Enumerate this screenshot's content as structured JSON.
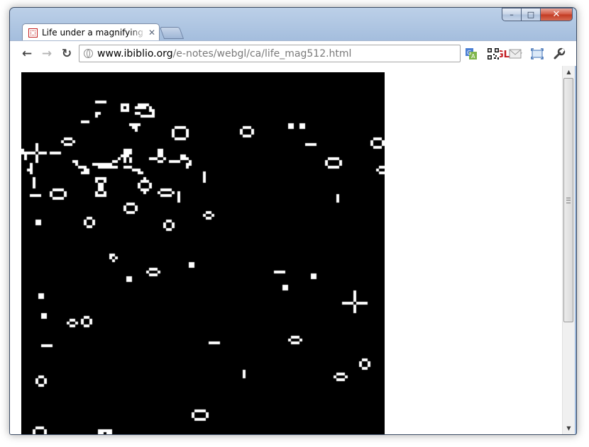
{
  "window": {
    "caption_buttons": {
      "minimize_icon": "minimize-icon",
      "maximize_icon": "maximize-icon",
      "close_icon": "close-icon"
    }
  },
  "tabs": [
    {
      "title": "Life under a magnifying gla",
      "active": true,
      "favicon": "canvas-favicon-icon"
    }
  ],
  "toolbar": {
    "back_icon": "back-arrow-icon",
    "forward_icon": "forward-arrow-icon",
    "reload_icon": "reload-icon",
    "omnibox": {
      "domain": "www.ibiblio.org",
      "path": "/e-notes/webgl/ca/life_mag512.html"
    },
    "badge": "GL",
    "extensions": [
      "translate-icon",
      "qr-code-icon",
      "mail-icon",
      "fullscreen-icon",
      "wrench-icon"
    ]
  },
  "colors": {
    "canvas_background": "#000000",
    "cell_color": "#ffffff",
    "gl_badge": "#c2191e"
  },
  "life_canvas": {
    "description_type": "conway-game-of-life-grid",
    "cells": [
      [
        26,
        10
      ],
      [
        27,
        10
      ],
      [
        28,
        10
      ],
      [
        29,
        10
      ],
      [
        35,
        11
      ],
      [
        36,
        11
      ],
      [
        37,
        11
      ],
      [
        35,
        12
      ],
      [
        37,
        12
      ],
      [
        35,
        13
      ],
      [
        36,
        13
      ],
      [
        37,
        13
      ],
      [
        40,
        12
      ],
      [
        41,
        12
      ],
      [
        42,
        12
      ],
      [
        41,
        11
      ],
      [
        42,
        11
      ],
      [
        43,
        11
      ],
      [
        44,
        11
      ],
      [
        43,
        12
      ],
      [
        45,
        12
      ],
      [
        45,
        13
      ],
      [
        46,
        13
      ],
      [
        46,
        14
      ],
      [
        40,
        14
      ],
      [
        41,
        14
      ],
      [
        42,
        15
      ],
      [
        43,
        15
      ],
      [
        44,
        15
      ],
      [
        45,
        15
      ],
      [
        46,
        15
      ],
      [
        21,
        17
      ],
      [
        22,
        17
      ],
      [
        23,
        17
      ],
      [
        26,
        14
      ],
      [
        27,
        14
      ],
      [
        26,
        15
      ],
      [
        54,
        19
      ],
      [
        55,
        19
      ],
      [
        56,
        19
      ],
      [
        57,
        19
      ],
      [
        54,
        23
      ],
      [
        55,
        23
      ],
      [
        56,
        23
      ],
      [
        57,
        23
      ],
      [
        53,
        20
      ],
      [
        53,
        21
      ],
      [
        53,
        22
      ],
      [
        58,
        20
      ],
      [
        58,
        21
      ],
      [
        58,
        22
      ],
      [
        38,
        18
      ],
      [
        39,
        18
      ],
      [
        40,
        18
      ],
      [
        41,
        18
      ],
      [
        39,
        19
      ],
      [
        40,
        19
      ],
      [
        40,
        20
      ],
      [
        78,
        19
      ],
      [
        79,
        19
      ],
      [
        80,
        19
      ],
      [
        77,
        20
      ],
      [
        81,
        20
      ],
      [
        77,
        21
      ],
      [
        81,
        21
      ],
      [
        78,
        22
      ],
      [
        79,
        22
      ],
      [
        80,
        22
      ],
      [
        94,
        18
      ],
      [
        95,
        18
      ],
      [
        94,
        19
      ],
      [
        95,
        19
      ],
      [
        98,
        18
      ],
      [
        99,
        18
      ],
      [
        98,
        19
      ],
      [
        99,
        19
      ],
      [
        100,
        25
      ],
      [
        101,
        25
      ],
      [
        102,
        25
      ],
      [
        103,
        25
      ],
      [
        124,
        23
      ],
      [
        125,
        23
      ],
      [
        126,
        23
      ],
      [
        123,
        24
      ],
      [
        127,
        24
      ],
      [
        123,
        25
      ],
      [
        127,
        25
      ],
      [
        124,
        26
      ],
      [
        125,
        26
      ],
      [
        126,
        26
      ],
      [
        15,
        23
      ],
      [
        16,
        23
      ],
      [
        17,
        23
      ],
      [
        14,
        24
      ],
      [
        18,
        24
      ],
      [
        15,
        25
      ],
      [
        16,
        25
      ],
      [
        17,
        25
      ],
      [
        5,
        25
      ],
      [
        5,
        26
      ],
      [
        5,
        27
      ],
      [
        1,
        28
      ],
      [
        2,
        28
      ],
      [
        3,
        28
      ],
      [
        4,
        28
      ],
      [
        6,
        28
      ],
      [
        7,
        28
      ],
      [
        8,
        28
      ],
      [
        5,
        29
      ],
      [
        5,
        30
      ],
      [
        5,
        31
      ],
      [
        10,
        28
      ],
      [
        11,
        28
      ],
      [
        12,
        28
      ],
      [
        13,
        28
      ],
      [
        36,
        27
      ],
      [
        37,
        27
      ],
      [
        38,
        27
      ],
      [
        36,
        28
      ],
      [
        37,
        28
      ],
      [
        38,
        28
      ],
      [
        36,
        29
      ],
      [
        37,
        29
      ],
      [
        36,
        30
      ],
      [
        38,
        30
      ],
      [
        36,
        31
      ],
      [
        38,
        31
      ],
      [
        35,
        29
      ],
      [
        34,
        30
      ],
      [
        33,
        31
      ],
      [
        32,
        31
      ],
      [
        31,
        32
      ],
      [
        30,
        32
      ],
      [
        29,
        32
      ],
      [
        28,
        32
      ],
      [
        27,
        32
      ],
      [
        26,
        32
      ],
      [
        25,
        32
      ],
      [
        27,
        33
      ],
      [
        28,
        33
      ],
      [
        29,
        33
      ],
      [
        30,
        33
      ],
      [
        31,
        33
      ],
      [
        32,
        33
      ],
      [
        33,
        33
      ],
      [
        36,
        33
      ],
      [
        37,
        33
      ],
      [
        38,
        33
      ],
      [
        18,
        31
      ],
      [
        19,
        31
      ],
      [
        19,
        32
      ],
      [
        20,
        33
      ],
      [
        21,
        33
      ],
      [
        22,
        33
      ],
      [
        22,
        34
      ],
      [
        23,
        34
      ],
      [
        21,
        35
      ],
      [
        22,
        35
      ],
      [
        23,
        35
      ],
      [
        39,
        34
      ],
      [
        40,
        34
      ],
      [
        41,
        34
      ],
      [
        41,
        35
      ],
      [
        42,
        35
      ],
      [
        48,
        27
      ],
      [
        49,
        27
      ],
      [
        48,
        28
      ],
      [
        49,
        28
      ],
      [
        48,
        29
      ],
      [
        49,
        29
      ],
      [
        47,
        30
      ],
      [
        50,
        30
      ],
      [
        48,
        31
      ],
      [
        49,
        31
      ],
      [
        45,
        30
      ],
      [
        46,
        30
      ],
      [
        52,
        31
      ],
      [
        53,
        31
      ],
      [
        54,
        31
      ],
      [
        55,
        31
      ],
      [
        56,
        30
      ],
      [
        57,
        30
      ],
      [
        58,
        30
      ],
      [
        56,
        29
      ],
      [
        57,
        29
      ],
      [
        0,
        27
      ],
      [
        0,
        28
      ],
      [
        1,
        29
      ],
      [
        1,
        30
      ],
      [
        3,
        32
      ],
      [
        3,
        33
      ],
      [
        3,
        34
      ],
      [
        3,
        35
      ],
      [
        2,
        34
      ],
      [
        108,
        30
      ],
      [
        109,
        30
      ],
      [
        110,
        30
      ],
      [
        111,
        30
      ],
      [
        107,
        31
      ],
      [
        112,
        31
      ],
      [
        107,
        32
      ],
      [
        112,
        32
      ],
      [
        108,
        33
      ],
      [
        109,
        33
      ],
      [
        110,
        33
      ],
      [
        111,
        33
      ],
      [
        126,
        33
      ],
      [
        127,
        33
      ],
      [
        128,
        33
      ],
      [
        125,
        34
      ],
      [
        129,
        34
      ],
      [
        126,
        35
      ],
      [
        127,
        35
      ],
      [
        128,
        35
      ],
      [
        58,
        32
      ],
      [
        59,
        32
      ],
      [
        59,
        31
      ],
      [
        58,
        33
      ],
      [
        64,
        35
      ],
      [
        64,
        36
      ],
      [
        64,
        37
      ],
      [
        64,
        38
      ],
      [
        4,
        37
      ],
      [
        4,
        38
      ],
      [
        4,
        39
      ],
      [
        4,
        40
      ],
      [
        11,
        41
      ],
      [
        12,
        41
      ],
      [
        13,
        41
      ],
      [
        14,
        41
      ],
      [
        10,
        42
      ],
      [
        15,
        42
      ],
      [
        10,
        43
      ],
      [
        15,
        43
      ],
      [
        11,
        44
      ],
      [
        12,
        44
      ],
      [
        13,
        44
      ],
      [
        14,
        44
      ],
      [
        3,
        43
      ],
      [
        4,
        43
      ],
      [
        5,
        43
      ],
      [
        6,
        43
      ],
      [
        42,
        38
      ],
      [
        43,
        38
      ],
      [
        44,
        38
      ],
      [
        41,
        39
      ],
      [
        45,
        39
      ],
      [
        41,
        40
      ],
      [
        45,
        40
      ],
      [
        42,
        41
      ],
      [
        43,
        41
      ],
      [
        44,
        41
      ],
      [
        43,
        37
      ],
      [
        43,
        42
      ],
      [
        26,
        37
      ],
      [
        27,
        37
      ],
      [
        28,
        37
      ],
      [
        29,
        37
      ],
      [
        26,
        38
      ],
      [
        29,
        38
      ],
      [
        27,
        39
      ],
      [
        28,
        39
      ],
      [
        27,
        40
      ],
      [
        28,
        40
      ],
      [
        27,
        41
      ],
      [
        28,
        41
      ],
      [
        26,
        42
      ],
      [
        29,
        42
      ],
      [
        26,
        43
      ],
      [
        27,
        43
      ],
      [
        28,
        43
      ],
      [
        29,
        43
      ],
      [
        49,
        41
      ],
      [
        50,
        41
      ],
      [
        51,
        41
      ],
      [
        52,
        41
      ],
      [
        48,
        42
      ],
      [
        53,
        42
      ],
      [
        49,
        43
      ],
      [
        50,
        43
      ],
      [
        51,
        43
      ],
      [
        52,
        43
      ],
      [
        55,
        42
      ],
      [
        55,
        43
      ],
      [
        55,
        44
      ],
      [
        55,
        45
      ],
      [
        111,
        43
      ],
      [
        111,
        44
      ],
      [
        111,
        45
      ],
      [
        37,
        46
      ],
      [
        38,
        46
      ],
      [
        39,
        46
      ],
      [
        36,
        47
      ],
      [
        40,
        47
      ],
      [
        36,
        48
      ],
      [
        40,
        48
      ],
      [
        37,
        49
      ],
      [
        38,
        49
      ],
      [
        39,
        49
      ],
      [
        5,
        52
      ],
      [
        6,
        52
      ],
      [
        5,
        53
      ],
      [
        6,
        53
      ],
      [
        23,
        51
      ],
      [
        24,
        51
      ],
      [
        22,
        52
      ],
      [
        25,
        52
      ],
      [
        22,
        53
      ],
      [
        25,
        53
      ],
      [
        23,
        54
      ],
      [
        24,
        54
      ],
      [
        24,
        51
      ],
      [
        65,
        49
      ],
      [
        66,
        49
      ],
      [
        64,
        50
      ],
      [
        67,
        50
      ],
      [
        65,
        51
      ],
      [
        66,
        51
      ],
      [
        51,
        52
      ],
      [
        52,
        52
      ],
      [
        50,
        53
      ],
      [
        53,
        53
      ],
      [
        50,
        54
      ],
      [
        53,
        54
      ],
      [
        51,
        55
      ],
      [
        52,
        55
      ],
      [
        31,
        64
      ],
      [
        32,
        64
      ],
      [
        31,
        65
      ],
      [
        33,
        65
      ],
      [
        32,
        66
      ],
      [
        45,
        69
      ],
      [
        46,
        69
      ],
      [
        47,
        69
      ],
      [
        44,
        70
      ],
      [
        48,
        70
      ],
      [
        45,
        71
      ],
      [
        46,
        71
      ],
      [
        47,
        71
      ],
      [
        37,
        72
      ],
      [
        38,
        72
      ],
      [
        37,
        73
      ],
      [
        38,
        73
      ],
      [
        59,
        67
      ],
      [
        60,
        67
      ],
      [
        59,
        68
      ],
      [
        60,
        68
      ],
      [
        89,
        70
      ],
      [
        90,
        70
      ],
      [
        91,
        70
      ],
      [
        92,
        70
      ],
      [
        102,
        71
      ],
      [
        103,
        71
      ],
      [
        102,
        72
      ],
      [
        103,
        72
      ],
      [
        117,
        77
      ],
      [
        117,
        78
      ],
      [
        117,
        79
      ],
      [
        117,
        80
      ],
      [
        92,
        75
      ],
      [
        93,
        75
      ],
      [
        92,
        76
      ],
      [
        93,
        76
      ],
      [
        113,
        81
      ],
      [
        114,
        81
      ],
      [
        115,
        81
      ],
      [
        116,
        81
      ],
      [
        118,
        81
      ],
      [
        119,
        81
      ],
      [
        120,
        81
      ],
      [
        121,
        81
      ],
      [
        117,
        82
      ],
      [
        117,
        83
      ],
      [
        117,
        84
      ],
      [
        6,
        78
      ],
      [
        7,
        78
      ],
      [
        6,
        79
      ],
      [
        7,
        79
      ],
      [
        7,
        85
      ],
      [
        8,
        85
      ],
      [
        7,
        86
      ],
      [
        8,
        86
      ],
      [
        17,
        87
      ],
      [
        18,
        87
      ],
      [
        16,
        88
      ],
      [
        19,
        88
      ],
      [
        17,
        89
      ],
      [
        18,
        89
      ],
      [
        22,
        86
      ],
      [
        23,
        86
      ],
      [
        21,
        87
      ],
      [
        24,
        87
      ],
      [
        21,
        88
      ],
      [
        24,
        88
      ],
      [
        22,
        89
      ],
      [
        23,
        89
      ],
      [
        7,
        96
      ],
      [
        8,
        96
      ],
      [
        9,
        96
      ],
      [
        10,
        96
      ],
      [
        66,
        95
      ],
      [
        67,
        95
      ],
      [
        68,
        95
      ],
      [
        69,
        95
      ],
      [
        95,
        93
      ],
      [
        96,
        93
      ],
      [
        97,
        93
      ],
      [
        94,
        94
      ],
      [
        98,
        94
      ],
      [
        95,
        95
      ],
      [
        96,
        95
      ],
      [
        97,
        95
      ],
      [
        120,
        101
      ],
      [
        121,
        101
      ],
      [
        119,
        102
      ],
      [
        122,
        102
      ],
      [
        119,
        103
      ],
      [
        122,
        103
      ],
      [
        120,
        104
      ],
      [
        121,
        104
      ],
      [
        78,
        105
      ],
      [
        78,
        106
      ],
      [
        78,
        107
      ],
      [
        111,
        106
      ],
      [
        112,
        106
      ],
      [
        113,
        106
      ],
      [
        110,
        107
      ],
      [
        114,
        107
      ],
      [
        111,
        108
      ],
      [
        112,
        108
      ],
      [
        113,
        108
      ],
      [
        6,
        107
      ],
      [
        7,
        107
      ],
      [
        5,
        108
      ],
      [
        8,
        108
      ],
      [
        5,
        109
      ],
      [
        8,
        109
      ],
      [
        6,
        110
      ],
      [
        7,
        110
      ],
      [
        61,
        119
      ],
      [
        62,
        119
      ],
      [
        63,
        119
      ],
      [
        64,
        119
      ],
      [
        60,
        120
      ],
      [
        60,
        121
      ],
      [
        65,
        120
      ],
      [
        65,
        121
      ],
      [
        61,
        122
      ],
      [
        62,
        122
      ],
      [
        63,
        122
      ],
      [
        64,
        122
      ],
      [
        5,
        125
      ],
      [
        6,
        125
      ],
      [
        7,
        125
      ],
      [
        4,
        126
      ],
      [
        8,
        126
      ],
      [
        4,
        127
      ],
      [
        8,
        127
      ],
      [
        27,
        126
      ],
      [
        28,
        126
      ],
      [
        29,
        126
      ],
      [
        30,
        126
      ],
      [
        31,
        126
      ],
      [
        27,
        127
      ],
      [
        28,
        127
      ],
      [
        30,
        127
      ],
      [
        31,
        127
      ]
    ]
  }
}
